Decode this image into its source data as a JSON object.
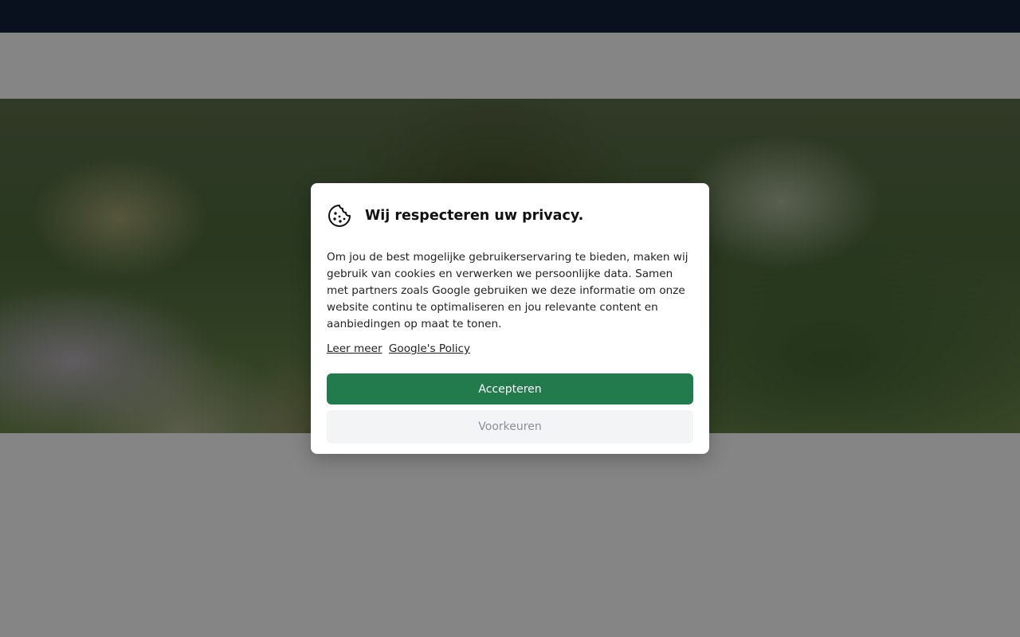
{
  "cookie_banner": {
    "icon": "cookie-icon",
    "title": "Wij respecteren uw privacy.",
    "body": "Om jou de best mogelijke gebruikerservaring te bieden, maken wij gebruik van cookies en verwerken we persoonlijke data. Samen met partners zoals Google gebruiken we deze informatie om onze website continu te optimaliseren en jou relevante content en aanbiedingen op maat te tonen.",
    "links": {
      "learn_more": "Leer meer",
      "google_policy": "Google's Policy"
    },
    "accept_label": "Accepteren",
    "preferences_label": "Voorkeuren"
  },
  "colors": {
    "top_bar": "#13213d",
    "accept_button": "#217b4d",
    "preferences_button": "#f3f4f6",
    "overlay": "rgba(0,0,0,0.48)"
  }
}
